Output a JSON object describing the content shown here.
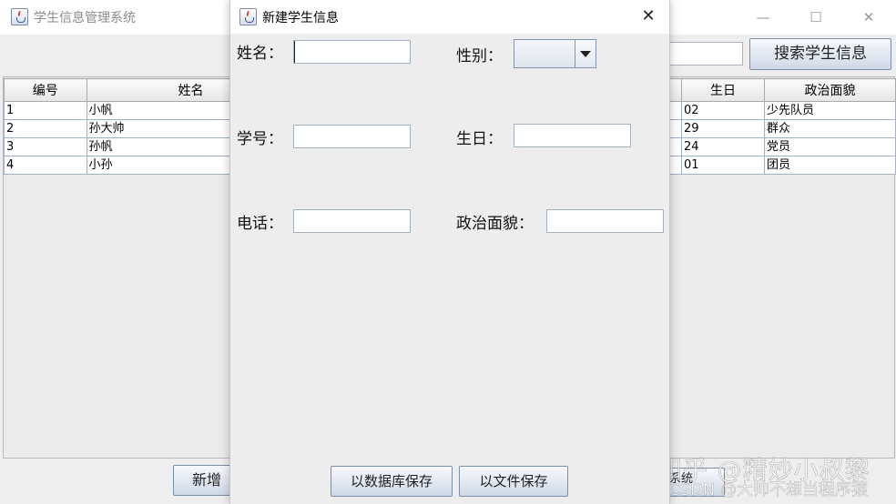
{
  "main_window": {
    "title": "学生信息管理系统",
    "controls": {
      "minimize": "—",
      "maximize": "☐",
      "close": "✕"
    },
    "search_button": "搜索学生信息",
    "table": {
      "columns": [
        "编号",
        "姓名",
        "",
        "生日",
        "政治面貌"
      ],
      "rows": [
        [
          "1",
          "小帆",
          "",
          "02",
          "少先队员"
        ],
        [
          "2",
          "孙大帅",
          "",
          "29",
          "群众"
        ],
        [
          "3",
          "孙帆",
          "",
          "24",
          "党员"
        ],
        [
          "4",
          "小孙",
          "",
          "01",
          "团员"
        ]
      ]
    },
    "add_button": "新增",
    "partial_button": "系统"
  },
  "watermark": {
    "line1": "知乎 @精妙小叔黎",
    "line2": "CSDN @大帅不想当程序猿"
  },
  "dialog": {
    "title": "新建学生信息",
    "close": "✕",
    "labels": {
      "name": "姓名：",
      "gender": "性别：",
      "student_id": "学号：",
      "birthday": "生日：",
      "phone": "电话：",
      "political_status": "政治面貌："
    },
    "values": {
      "name": "",
      "gender": "",
      "student_id": "",
      "birthday": "",
      "phone": "",
      "political_status": ""
    },
    "buttons": {
      "save_db": "以数据库保存",
      "save_file": "以文件保存"
    }
  }
}
